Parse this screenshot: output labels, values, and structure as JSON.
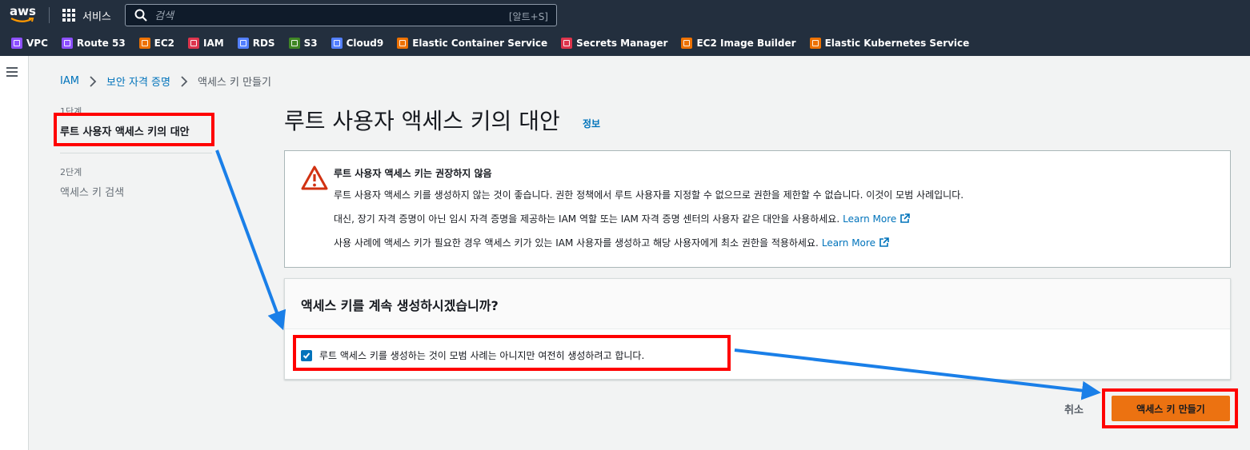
{
  "topnav": {
    "logo": "aws",
    "services_label": "서비스",
    "search_placeholder": "검색",
    "search_shortcut": "[알트+S]"
  },
  "favorites": [
    {
      "label": "VPC",
      "color": "#8c4fff"
    },
    {
      "label": "Route 53",
      "color": "#8c4fff"
    },
    {
      "label": "EC2",
      "color": "#ed7100"
    },
    {
      "label": "IAM",
      "color": "#dd344c"
    },
    {
      "label": "RDS",
      "color": "#527fff"
    },
    {
      "label": "S3",
      "color": "#3f8624"
    },
    {
      "label": "Cloud9",
      "color": "#527fff"
    },
    {
      "label": "Elastic Container Service",
      "color": "#ed7100"
    },
    {
      "label": "Secrets Manager",
      "color": "#dd344c"
    },
    {
      "label": "EC2 Image Builder",
      "color": "#ed7100"
    },
    {
      "label": "Elastic Kubernetes Service",
      "color": "#ed7100"
    }
  ],
  "breadcrumb": {
    "item1": "IAM",
    "item2": "보안 자격 증명",
    "current": "액세스 키 만들기"
  },
  "steps": {
    "step1_label": "1단계",
    "step1_title": "루트 사용자 액세스 키의 대안",
    "step2_label": "2단계",
    "step2_title": "액세스 키 검색"
  },
  "page": {
    "title": "루트 사용자 액세스 키의 대안",
    "info_link": "정보"
  },
  "warning": {
    "title": "루트 사용자 액세스 키는 권장하지 않음",
    "line1": "루트 사용자 액세스 키를 생성하지 않는 것이 좋습니다. 권한 정책에서 루트 사용자를 지정할 수 없으므로 권한을 제한할 수 없습니다. 이것이 모범 사례입니다.",
    "line2": "대신, 장기 자격 증명이 아닌 임시 자격 증명을 제공하는 IAM 역할 또는 IAM 자격 증명 센터의 사용자 같은 대안을 사용하세요.",
    "line3": "사용 사례에 액세스 키가 필요한 경우 액세스 키가 있는 IAM 사용자를 생성하고 해당 사용자에게 최소 권한을 적용하세요.",
    "learn_more": "Learn More"
  },
  "question": {
    "title": "액세스 키를 계속 생성하시겠습니까?",
    "checkbox_label": "루트 액세스 키를 생성하는 것이 모범 사례는 아니지만 여전히 생성하려고 합니다.",
    "checked": true
  },
  "actions": {
    "cancel": "취소",
    "create": "액세스 키 만들기"
  },
  "colors": {
    "nav_bg": "#232f3e",
    "link": "#0073bb",
    "primary_button": "#ec7211",
    "annotation_box": "#ff0000",
    "annotation_arrow": "#1a7fe8"
  }
}
